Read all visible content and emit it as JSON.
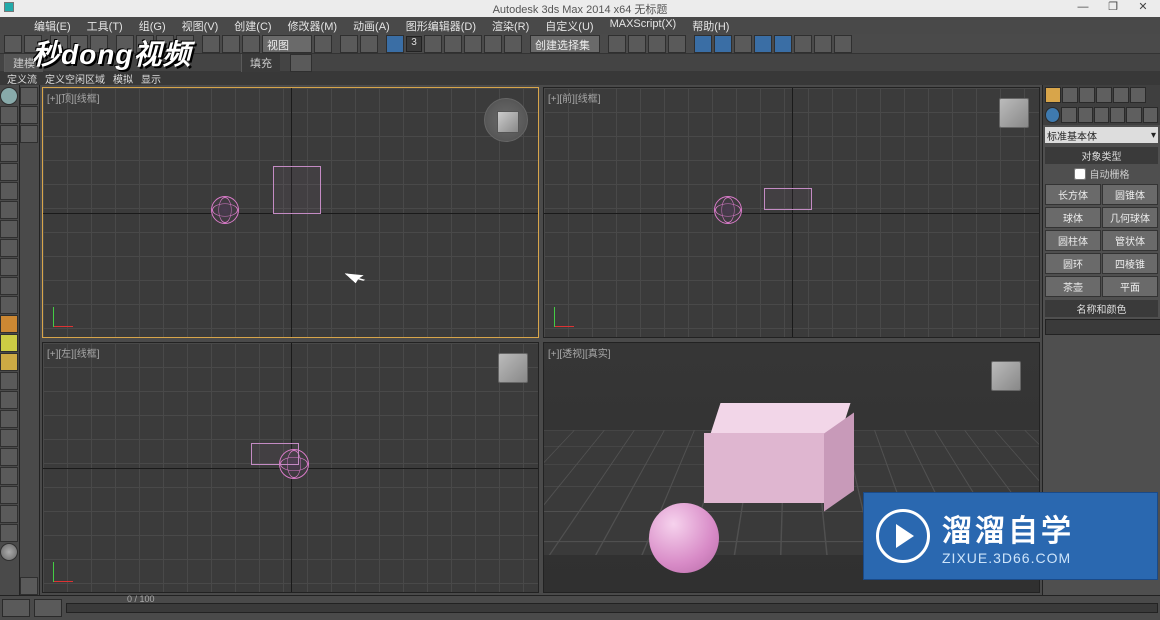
{
  "titlebar": {
    "title": "Autodesk 3ds Max  2014 x64    无标题",
    "min": "—",
    "restore": "❐",
    "close": "✕"
  },
  "menus": [
    "编辑(E)",
    "工具(T)",
    "组(G)",
    "视图(V)",
    "创建(C)",
    "修改器(M)",
    "动画(A)",
    "图形编辑器(D)",
    "渲染(R)",
    "自定义(U)",
    "MAXScript(X)",
    "帮助(H)"
  ],
  "toolbar": {
    "grid_dropdown": "视图",
    "spinner": "3",
    "selset_dropdown": "创建选择集"
  },
  "tabs": {
    "main": [
      "建模",
      "填充"
    ],
    "sub": [
      "定义流",
      "定义空闲区域",
      "模拟",
      "显示"
    ]
  },
  "viewports": {
    "top": {
      "label": "[+][顶][线框]"
    },
    "front": {
      "label": "[+][前][线框]"
    },
    "left": {
      "label": "[+][左][线框]"
    },
    "persp": {
      "label": "[+][透视][真实]"
    }
  },
  "command_panel": {
    "dropdown": "标准基本体",
    "rollout1": "对象类型",
    "autogrid": "自动栅格",
    "buttons": [
      [
        "长方体",
        "圆锥体"
      ],
      [
        "球体",
        "几何球体"
      ],
      [
        "圆柱体",
        "管状体"
      ],
      [
        "圆环",
        "四棱锥"
      ],
      [
        "茶壶",
        "平面"
      ]
    ],
    "rollout2": "名称和颜色",
    "name_value": ""
  },
  "bottom": {
    "frame_label": "0 / 100"
  },
  "overlay": {
    "logo": "秒dong视频",
    "watermark_big": "溜溜自学",
    "watermark_small": "ZIXUE.3D66.COM"
  }
}
